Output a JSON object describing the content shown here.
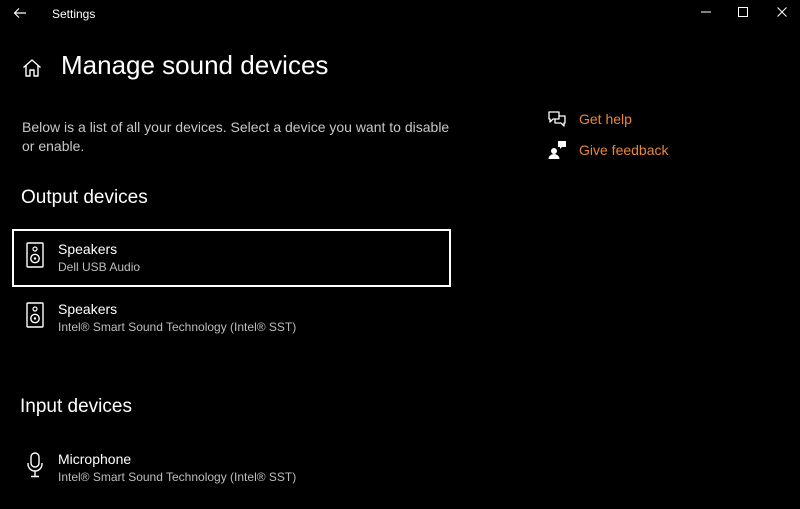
{
  "window": {
    "app_title": "Settings"
  },
  "page": {
    "title": "Manage sound devices",
    "description": "Below is a list of all your devices. Select a device you want to disable or enable."
  },
  "output_section": {
    "heading": "Output devices",
    "devices": [
      {
        "name": "Speakers",
        "detail": "Dell USB Audio",
        "icon": "speaker-icon",
        "selected": true
      },
      {
        "name": "Speakers",
        "detail": "Intel® Smart Sound Technology (Intel® SST)",
        "icon": "speaker-icon",
        "selected": false
      }
    ]
  },
  "input_section": {
    "heading": "Input devices",
    "devices": [
      {
        "name": "Microphone",
        "detail": "Intel® Smart Sound Technology (Intel® SST)",
        "icon": "microphone-icon",
        "selected": false
      }
    ]
  },
  "side_links": [
    {
      "label": "Get help",
      "icon": "help-chat-icon"
    },
    {
      "label": "Give feedback",
      "icon": "feedback-person-icon"
    }
  ],
  "colors": {
    "background": "#000000",
    "link_accent": "#e8873a",
    "selection_border": "#ffffff"
  }
}
